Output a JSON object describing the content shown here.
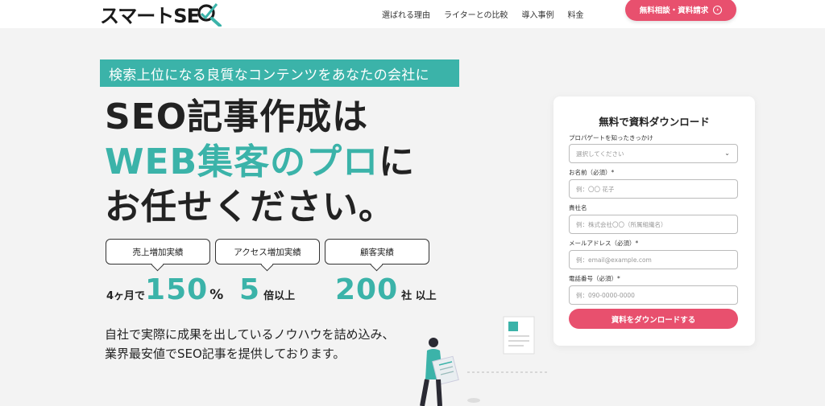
{
  "header": {
    "logo_text": "スマートSE",
    "nav": [
      "選ばれる理由",
      "ライターとの比較",
      "導入事例",
      "料金"
    ],
    "cta_label": "無料相談・資料請求"
  },
  "hero": {
    "tagline": "検索上位になる良質なコンテンツをあなたの会社に",
    "headline_line1": "SEO記事作成は",
    "headline_line2_accent": "WEB集客のプロ",
    "headline_line2_suffix": "に",
    "headline_line3": "お任せください。",
    "stats": [
      {
        "label": "売上増加実績",
        "prefix": "4ヶ月で",
        "value": "150",
        "suffix": "%"
      },
      {
        "label": "アクセス増加実績",
        "prefix": "",
        "value": "5",
        "suffix": "倍以上"
      },
      {
        "label": "顧客実績",
        "prefix": "",
        "value": "200",
        "suffix": "社 以上"
      }
    ],
    "description_line1": "自社で実際に成果を出しているノウハウを詰め込み、",
    "description_line2": "業界最安値でSEO記事を提供しております。"
  },
  "form": {
    "title": "無料で資料ダウンロード",
    "fields": [
      {
        "label": "プロパゲートを知ったきっかけ",
        "placeholder": "選択してください",
        "type": "select"
      },
      {
        "label": "お名前（必須）*",
        "placeholder": "例：〇〇 花子",
        "type": "text"
      },
      {
        "label": "貴社名",
        "placeholder": "例：株式会社〇〇（所属組織名）",
        "type": "text"
      },
      {
        "label": "メールアドレス（必須）*",
        "placeholder": "例：email@example.com",
        "type": "text"
      },
      {
        "label": "電話番号（必須）*",
        "placeholder": "例：090-0000-0000",
        "type": "text"
      }
    ],
    "submit_label": "資料をダウンロードする"
  },
  "colors": {
    "accent_teal": "#3bb3a9",
    "accent_pink": "#e8506e",
    "background": "#f3f3f3"
  }
}
